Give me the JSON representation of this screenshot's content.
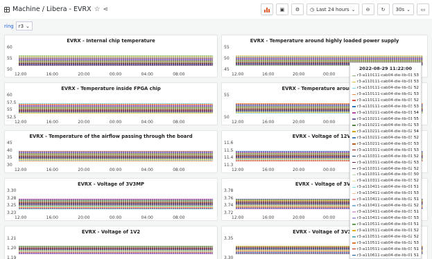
{
  "header": {
    "breadcrumb": "Machine / Libera - EVRX",
    "time_range": "Last 24 hours",
    "refresh_interval": "30s"
  },
  "variables": {
    "label": "ring",
    "value": "r3"
  },
  "x_ticks": [
    "12:00",
    "16:00",
    "20:00",
    "00:00",
    "04:00",
    "08:00"
  ],
  "panels": {
    "chip_temp": {
      "title": "EVRX - Internal chip temperature",
      "y_ticks": [
        "60",
        "55",
        "50"
      ]
    },
    "power_temp": {
      "title": "EVRX - Temperature around highly loaded power supply",
      "y_ticks": [
        "55",
        "50",
        "45"
      ]
    },
    "fpga_temp": {
      "title": "EVRX - Temperature inside FPGA chip",
      "y_ticks": [
        "60",
        "57.5",
        "55",
        "52.5"
      ]
    },
    "imp_temp": {
      "title": "EVRX - Temperature around imp",
      "y_ticks": [
        "55",
        "50"
      ]
    },
    "airflow_temp": {
      "title": "EVRX - Temperature of the airflow passing through the board",
      "y_ticks": [
        "45",
        "40",
        "35",
        "30"
      ]
    },
    "v12": {
      "title": "EVRX - Voltage of 12V_A",
      "y_ticks": [
        "11.6",
        "11.5",
        "11.4",
        "11.3"
      ]
    },
    "v3v3mp": {
      "title": "EVRX - Voltage of 3V3MP",
      "y_ticks": [
        "3.30",
        "3.28",
        "3.25",
        "3.23"
      ]
    },
    "v3v7": {
      "title": "EVRX - Voltage of 3V7",
      "y_ticks": [
        "3.78",
        "3.76",
        "3.74",
        "3.72"
      ]
    },
    "v1v2": {
      "title": "EVRX - Voltage of 1V2",
      "y_ticks": [
        "1.21",
        "1.20",
        "1.19"
      ]
    },
    "v3v3ci": {
      "title": "EVRX - Voltage of 3V3CI",
      "y_ticks": [
        "3.35",
        "3.30"
      ]
    }
  },
  "tooltip": {
    "time": "2022-08-29 11:22:00",
    "rows": [
      {
        "name": "r3-a110111-cab04-die-lib-01:",
        "value": "53",
        "color": "#7eb26d"
      },
      {
        "name": "r3-a110111-cab04-die-lib-01:",
        "value": "53",
        "color": "#eab839"
      },
      {
        "name": "r3-a110111-cab04-die-lib-02:",
        "value": "52",
        "color": "#6ed0e0"
      },
      {
        "name": "r3-a110111-cab04-die-lib-02:",
        "value": "53",
        "color": "#ef843c"
      },
      {
        "name": "r3-a110111-cab04-die-lib-03:",
        "value": "52",
        "color": "#e24d42"
      },
      {
        "name": "r3-a110111-cab04-die-lib-03:",
        "value": "53",
        "color": "#1f78c1"
      },
      {
        "name": "r3-a110211-cab04-die-lib-01:",
        "value": "54",
        "color": "#ba43a9"
      },
      {
        "name": "r3-a110211-cab04-die-lib-01:",
        "value": "55",
        "color": "#705da0"
      },
      {
        "name": "r3-a110211-cab04-die-lib-02:",
        "value": "53",
        "color": "#508642"
      },
      {
        "name": "r3-a110211-cab04-die-lib-02:",
        "value": "54",
        "color": "#cca300"
      },
      {
        "name": "r3-a110211-cab04-die-lib-03:",
        "value": "52",
        "color": "#447ebc"
      },
      {
        "name": "r3-a110211-cab04-die-lib-03:",
        "value": "53",
        "color": "#c15c17"
      },
      {
        "name": "r3-a110311-cab04-die-lib-01:",
        "value": "53",
        "color": "#890f02"
      },
      {
        "name": "r3-a110311-cab04-die-lib-01:",
        "value": "52",
        "color": "#0a437c"
      },
      {
        "name": "r3-a110311-cab04-die-lib-02:",
        "value": "53",
        "color": "#6d1f62"
      },
      {
        "name": "r3-a110311-cab04-die-lib-02:",
        "value": "52",
        "color": "#584477"
      },
      {
        "name": "r3-a110311-cab04-die-lib-03:",
        "value": "50",
        "color": "#b7dbab"
      },
      {
        "name": "r3-a110311-cab04-die-lib-03:",
        "value": "52",
        "color": "#f4d598"
      },
      {
        "name": "r3-a110411-cab04-die-lib-01:",
        "value": "51",
        "color": "#70dbed"
      },
      {
        "name": "r3-a110411-cab04-die-lib-01:",
        "value": "53",
        "color": "#f9ba8f"
      },
      {
        "name": "r3-a110411-cab04-die-lib-02:",
        "value": "51",
        "color": "#f29191"
      },
      {
        "name": "r3-a110411-cab04-die-lib-02:",
        "value": "52",
        "color": "#82b5d8"
      },
      {
        "name": "r3-a110411-cab04-die-lib-03:",
        "value": "51",
        "color": "#e5a8e2"
      },
      {
        "name": "r3-a110411-cab04-die-lib-03:",
        "value": "53",
        "color": "#aea2e0"
      },
      {
        "name": "r3-a110511-cab04-die-lib-01:",
        "value": "51",
        "color": "#629e51"
      },
      {
        "name": "r3-a110511-cab04-die-lib-01:",
        "value": "52",
        "color": "#e5ac0e"
      },
      {
        "name": "r3-a110511-cab04-die-lib-02:",
        "value": "52",
        "color": "#64b0c8"
      },
      {
        "name": "r3-a110511-cab04-die-lib-02:",
        "value": "53",
        "color": "#e0752d"
      },
      {
        "name": "r3-a110511-cab04-die-lib-03:",
        "value": "51",
        "color": "#bf1b00"
      },
      {
        "name": "r3-a110611-cab04-die-lib-01:",
        "value": "51",
        "color": "#0a50a1"
      }
    ]
  }
}
